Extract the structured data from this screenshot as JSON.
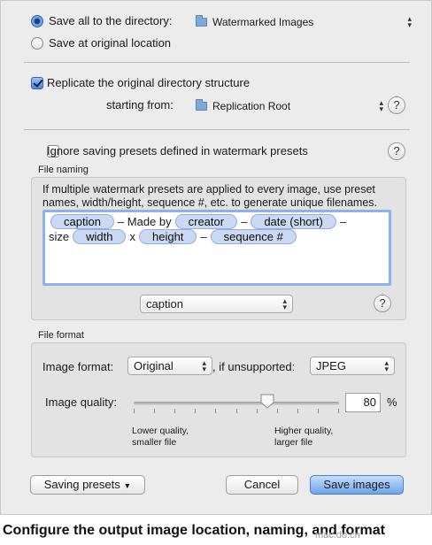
{
  "save": {
    "option_directory": "Save all to the directory:",
    "directory_value": "Watermarked Images",
    "option_original": "Save at original location"
  },
  "replicate": {
    "label": "Replicate the original directory structure",
    "starting_from_label": "starting from:",
    "starting_from_value": "Replication Root"
  },
  "ignore_presets": {
    "label": "Ignore saving presets defined in watermark presets"
  },
  "file_naming": {
    "legend": "File naming",
    "description": "If multiple watermark presets are applied to every image, use preset names, width/height, sequence #, etc. to generate unique filenames.",
    "tokens_line1": [
      {
        "type": "token",
        "text": "caption"
      },
      {
        "type": "text",
        "text": "– Made by"
      },
      {
        "type": "token",
        "text": "creator"
      },
      {
        "type": "text",
        "text": "–"
      },
      {
        "type": "token",
        "text": "date (short)"
      },
      {
        "type": "text",
        "text": "–"
      }
    ],
    "tokens_line2": [
      {
        "type": "text",
        "text": "size"
      },
      {
        "type": "token",
        "text": "width"
      },
      {
        "type": "text",
        "text": "x"
      },
      {
        "type": "token",
        "text": "height"
      },
      {
        "type": "text",
        "text": "–"
      },
      {
        "type": "token",
        "text": "sequence #"
      }
    ],
    "token_popup_value": "caption"
  },
  "file_format": {
    "legend": "File format",
    "image_format_label": "Image format:",
    "image_format_value": "Original",
    "unsupported_label": ", if unsupported:",
    "unsupported_value": "JPEG",
    "quality_label": "Image quality:",
    "quality_value": "80",
    "quality_fraction": 0.65,
    "quality_unit": "%",
    "low_hint_line1": "Lower quality,",
    "low_hint_line2": "smaller file",
    "high_hint_line1": "Higher quality,",
    "high_hint_line2": "larger file"
  },
  "buttons": {
    "saving_presets": "Saving presets",
    "cancel": "Cancel",
    "save_images": "Save images"
  },
  "help_glyph": "?",
  "caption": "Configure the output image location, naming, and format",
  "watermark": "mac.do.cn"
}
